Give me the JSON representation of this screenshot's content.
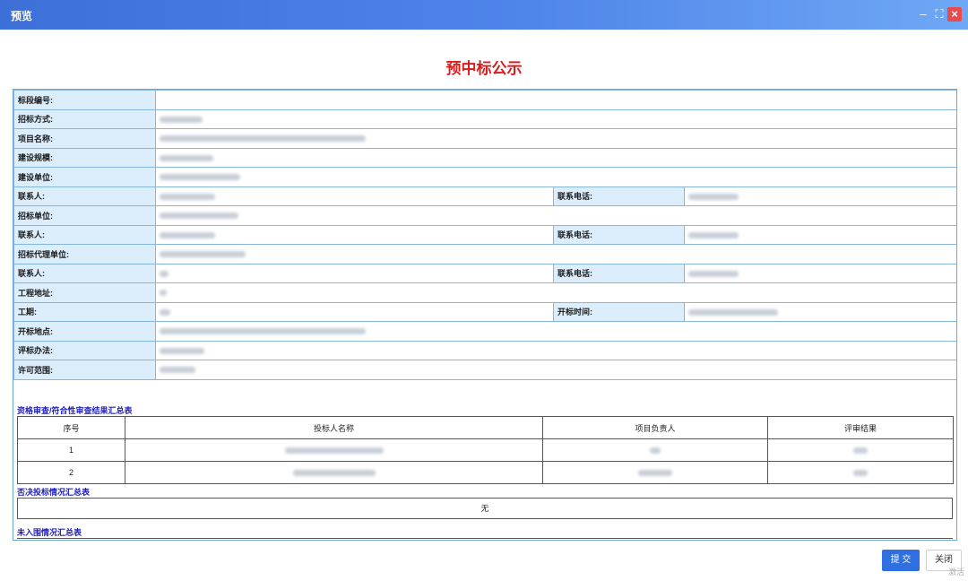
{
  "window": {
    "title": "预览"
  },
  "heading": "预中标公示",
  "info_rows": [
    {
      "label": "标段编号:",
      "type": "single"
    },
    {
      "label": "招标方式:",
      "type": "single"
    },
    {
      "label": "项目名称:",
      "type": "single"
    },
    {
      "label": "建设规模:",
      "type": "single"
    },
    {
      "label": "建设单位:",
      "type": "single"
    },
    {
      "label": "联系人:",
      "type": "double",
      "label2": "联系电话:"
    },
    {
      "label": "招标单位:",
      "type": "single"
    },
    {
      "label": "联系人:",
      "type": "double",
      "label2": "联系电话:"
    },
    {
      "label": "招标代理单位:",
      "type": "single"
    },
    {
      "label": "联系人:",
      "type": "double",
      "label2": "联系电话:"
    },
    {
      "label": "工程地址:",
      "type": "single"
    },
    {
      "label": "工期:",
      "type": "double",
      "label2": "开标时间:"
    },
    {
      "label": "开标地点:",
      "type": "single"
    },
    {
      "label": "评标办法:",
      "type": "single"
    },
    {
      "label": "许可范围:",
      "type": "single"
    }
  ],
  "qualification": {
    "title": "资格审查/符合性审查结果汇总表",
    "headers": [
      "序号",
      "投标人名称",
      "项目负责人",
      "评审结果"
    ],
    "rows": [
      [
        "1"
      ],
      [
        "2"
      ]
    ]
  },
  "rejection": {
    "title": "否决投标情况汇总表",
    "value": "无"
  },
  "not_shortlisted": {
    "title": "未入围情况汇总表"
  },
  "buttons": {
    "submit": "提 交",
    "close": "关闭"
  },
  "watermark": "激活"
}
